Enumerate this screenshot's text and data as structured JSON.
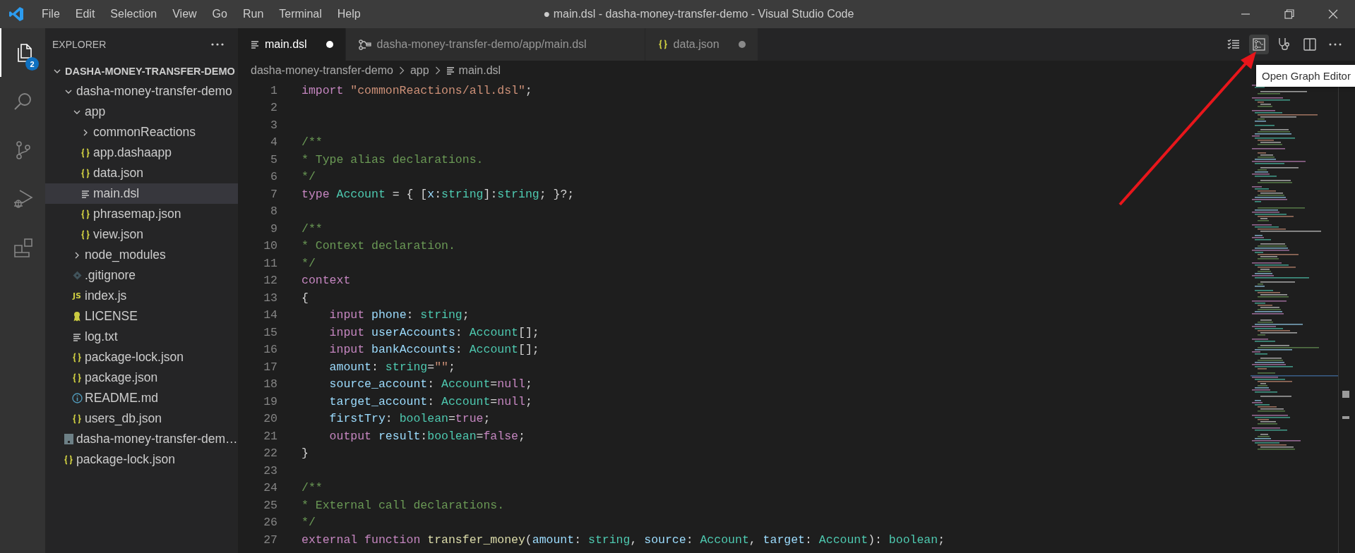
{
  "title_bar": {
    "menus": [
      "File",
      "Edit",
      "Selection",
      "View",
      "Go",
      "Run",
      "Terminal",
      "Help"
    ],
    "title": "● main.dsl - dasha-money-transfer-demo - Visual Studio Code"
  },
  "activity_bar": [
    {
      "kind": "files",
      "selected": true,
      "badge": "2"
    },
    {
      "kind": "search",
      "selected": false
    },
    {
      "kind": "source-control",
      "selected": false
    },
    {
      "kind": "run-debug",
      "selected": false
    },
    {
      "kind": "extensions",
      "selected": false
    }
  ],
  "explorer": {
    "title": "EXPLORER",
    "tree": [
      {
        "label": "DASHA-MONEY-TRANSFER-DEMO",
        "kind": "section",
        "expanded": true,
        "selected": false,
        "children": [
          {
            "label": "dasha-money-transfer-demo",
            "kind": "folder",
            "expanded": true,
            "selected": false,
            "children": [
              {
                "label": "app",
                "kind": "folder",
                "expanded": true,
                "selected": false,
                "children": [
                  {
                    "label": "commonReactions",
                    "kind": "folder",
                    "expanded": false,
                    "selected": false
                  },
                  {
                    "label": "app.dashaapp",
                    "kind": "json",
                    "selected": false
                  },
                  {
                    "label": "data.json",
                    "kind": "json",
                    "selected": false
                  },
                  {
                    "label": "main.dsl",
                    "kind": "lines",
                    "selected": true
                  },
                  {
                    "label": "phrasemap.json",
                    "kind": "json",
                    "selected": false
                  },
                  {
                    "label": "view.json",
                    "kind": "json",
                    "selected": false
                  }
                ]
              },
              {
                "label": "node_modules",
                "kind": "folder",
                "expanded": false,
                "selected": false
              },
              {
                "label": ".gitignore",
                "kind": "git",
                "selected": false
              },
              {
                "label": "index.js",
                "kind": "js",
                "icon_text": "JS",
                "selected": false
              },
              {
                "label": "LICENSE",
                "kind": "license",
                "selected": false
              },
              {
                "label": "log.txt",
                "kind": "lines",
                "selected": false
              },
              {
                "label": "package-lock.json",
                "kind": "json",
                "selected": false
              },
              {
                "label": "package.json",
                "kind": "json",
                "selected": false
              },
              {
                "label": "README.md",
                "kind": "info",
                "selected": false
              },
              {
                "label": "users_db.json",
                "kind": "json",
                "selected": false
              }
            ]
          },
          {
            "label": "dasha-money-transfer-dem…",
            "kind": "archive",
            "selected": false
          },
          {
            "label": "package-lock.json",
            "kind": "json",
            "selected": false
          }
        ]
      }
    ]
  },
  "tabs": [
    {
      "label": "main.dsl",
      "kind": "lines",
      "selected": true,
      "dirty": true
    },
    {
      "label": "dasha-money-transfer-demo/app/main.dsl",
      "kind": "graph",
      "selected": false,
      "dirty": false
    },
    {
      "label": "data.json",
      "kind": "json",
      "selected": false,
      "dirty": true
    }
  ],
  "editor_actions": [
    {
      "kind": "checklist",
      "hovered": false
    },
    {
      "kind": "graph",
      "hovered": true
    },
    {
      "kind": "stethoscope",
      "hovered": false
    },
    {
      "kind": "split",
      "hovered": false
    },
    {
      "kind": "more",
      "hovered": false
    }
  ],
  "tooltip": "Open Graph Editor",
  "breadcrumb": [
    {
      "label": "dasha-money-transfer-demo",
      "kind": "folder"
    },
    {
      "label": "app",
      "kind": "folder"
    },
    {
      "label": "main.dsl",
      "kind": "lines"
    }
  ],
  "code": [
    {
      "number": "1",
      "tokens": [
        {
          "kind": "keyword",
          "text": "import "
        },
        {
          "kind": "string",
          "text": "\"commonReactions/all.dsl\""
        },
        {
          "kind": "plain",
          "text": ";"
        }
      ]
    },
    {
      "number": "2"
    },
    {
      "number": "3"
    },
    {
      "number": "4",
      "tokens": [
        {
          "kind": "comment",
          "text": "/**"
        }
      ]
    },
    {
      "number": "5",
      "tokens": [
        {
          "kind": "comment",
          "text": "* Type alias declarations."
        }
      ]
    },
    {
      "number": "6",
      "tokens": [
        {
          "kind": "comment",
          "text": "*/"
        }
      ]
    },
    {
      "number": "7",
      "tokens": [
        {
          "kind": "keyword",
          "text": "type "
        },
        {
          "kind": "type",
          "text": "Account"
        },
        {
          "kind": "plain",
          "text": " = { ["
        },
        {
          "kind": "variable",
          "text": "x"
        },
        {
          "kind": "plain",
          "text": ":"
        },
        {
          "kind": "type",
          "text": "string"
        },
        {
          "kind": "plain",
          "text": "]:"
        },
        {
          "kind": "type",
          "text": "string"
        },
        {
          "kind": "plain",
          "text": "; }?;"
        }
      ]
    },
    {
      "number": "8"
    },
    {
      "number": "9",
      "tokens": [
        {
          "kind": "comment",
          "text": "/**"
        }
      ]
    },
    {
      "number": "10",
      "tokens": [
        {
          "kind": "comment",
          "text": "* Context declaration."
        }
      ]
    },
    {
      "number": "11",
      "tokens": [
        {
          "kind": "comment",
          "text": "*/"
        }
      ]
    },
    {
      "number": "12",
      "tokens": [
        {
          "kind": "keyword",
          "text": "context"
        }
      ]
    },
    {
      "number": "13",
      "tokens": [
        {
          "kind": "plain",
          "text": "{"
        }
      ]
    },
    {
      "number": "14",
      "tokens": [
        {
          "kind": "keyword",
          "text": "    input "
        },
        {
          "kind": "variable",
          "text": "phone"
        },
        {
          "kind": "plain",
          "text": ": "
        },
        {
          "kind": "type",
          "text": "string"
        },
        {
          "kind": "plain",
          "text": ";"
        }
      ]
    },
    {
      "number": "15",
      "tokens": [
        {
          "kind": "keyword",
          "text": "    input "
        },
        {
          "kind": "variable",
          "text": "userAccounts"
        },
        {
          "kind": "plain",
          "text": ": "
        },
        {
          "kind": "type",
          "text": "Account"
        },
        {
          "kind": "plain",
          "text": "[];"
        }
      ]
    },
    {
      "number": "16",
      "tokens": [
        {
          "kind": "keyword",
          "text": "    input "
        },
        {
          "kind": "variable",
          "text": "bankAccounts"
        },
        {
          "kind": "plain",
          "text": ": "
        },
        {
          "kind": "type",
          "text": "Account"
        },
        {
          "kind": "plain",
          "text": "[];"
        }
      ]
    },
    {
      "number": "17",
      "tokens": [
        {
          "kind": "variable",
          "text": "    amount"
        },
        {
          "kind": "plain",
          "text": ": "
        },
        {
          "kind": "type",
          "text": "string"
        },
        {
          "kind": "plain",
          "text": "="
        },
        {
          "kind": "string",
          "text": "\"\""
        },
        {
          "kind": "plain",
          "text": ";"
        }
      ]
    },
    {
      "number": "18",
      "tokens": [
        {
          "kind": "variable",
          "text": "    source_account"
        },
        {
          "kind": "plain",
          "text": ": "
        },
        {
          "kind": "type",
          "text": "Account"
        },
        {
          "kind": "plain",
          "text": "="
        },
        {
          "kind": "keyword",
          "text": "null"
        },
        {
          "kind": "plain",
          "text": ";"
        }
      ]
    },
    {
      "number": "19",
      "tokens": [
        {
          "kind": "variable",
          "text": "    target_account"
        },
        {
          "kind": "plain",
          "text": ": "
        },
        {
          "kind": "type",
          "text": "Account"
        },
        {
          "kind": "plain",
          "text": "="
        },
        {
          "kind": "keyword",
          "text": "null"
        },
        {
          "kind": "plain",
          "text": ";"
        }
      ]
    },
    {
      "number": "20",
      "tokens": [
        {
          "kind": "variable",
          "text": "    firstTry"
        },
        {
          "kind": "plain",
          "text": ": "
        },
        {
          "kind": "type",
          "text": "boolean"
        },
        {
          "kind": "plain",
          "text": "="
        },
        {
          "kind": "keyword",
          "text": "true"
        },
        {
          "kind": "plain",
          "text": ";"
        }
      ]
    },
    {
      "number": "21",
      "tokens": [
        {
          "kind": "keyword",
          "text": "    output "
        },
        {
          "kind": "variable",
          "text": "result"
        },
        {
          "kind": "plain",
          "text": ":"
        },
        {
          "kind": "type",
          "text": "boolean"
        },
        {
          "kind": "plain",
          "text": "="
        },
        {
          "kind": "keyword",
          "text": "false"
        },
        {
          "kind": "plain",
          "text": ";"
        }
      ]
    },
    {
      "number": "22",
      "tokens": [
        {
          "kind": "plain",
          "text": "}"
        }
      ]
    },
    {
      "number": "23"
    },
    {
      "number": "24",
      "tokens": [
        {
          "kind": "comment",
          "text": "/**"
        }
      ]
    },
    {
      "number": "25",
      "tokens": [
        {
          "kind": "comment",
          "text": "* External call declarations."
        }
      ]
    },
    {
      "number": "26",
      "tokens": [
        {
          "kind": "comment",
          "text": "*/"
        }
      ]
    },
    {
      "number": "27",
      "tokens": [
        {
          "kind": "keyword",
          "text": "external function "
        },
        {
          "kind": "function",
          "text": "transfer_money"
        },
        {
          "kind": "plain",
          "text": "("
        },
        {
          "kind": "variable",
          "text": "amount"
        },
        {
          "kind": "plain",
          "text": ": "
        },
        {
          "kind": "type",
          "text": "string"
        },
        {
          "kind": "plain",
          "text": ", "
        },
        {
          "kind": "variable",
          "text": "source"
        },
        {
          "kind": "plain",
          "text": ": "
        },
        {
          "kind": "type",
          "text": "Account"
        },
        {
          "kind": "plain",
          "text": ", "
        },
        {
          "kind": "variable",
          "text": "target"
        },
        {
          "kind": "plain",
          "text": ": "
        },
        {
          "kind": "type",
          "text": "Account"
        },
        {
          "kind": "plain",
          "text": "): "
        },
        {
          "kind": "type",
          "text": "boolean"
        },
        {
          "kind": "plain",
          "text": ";"
        }
      ]
    }
  ]
}
